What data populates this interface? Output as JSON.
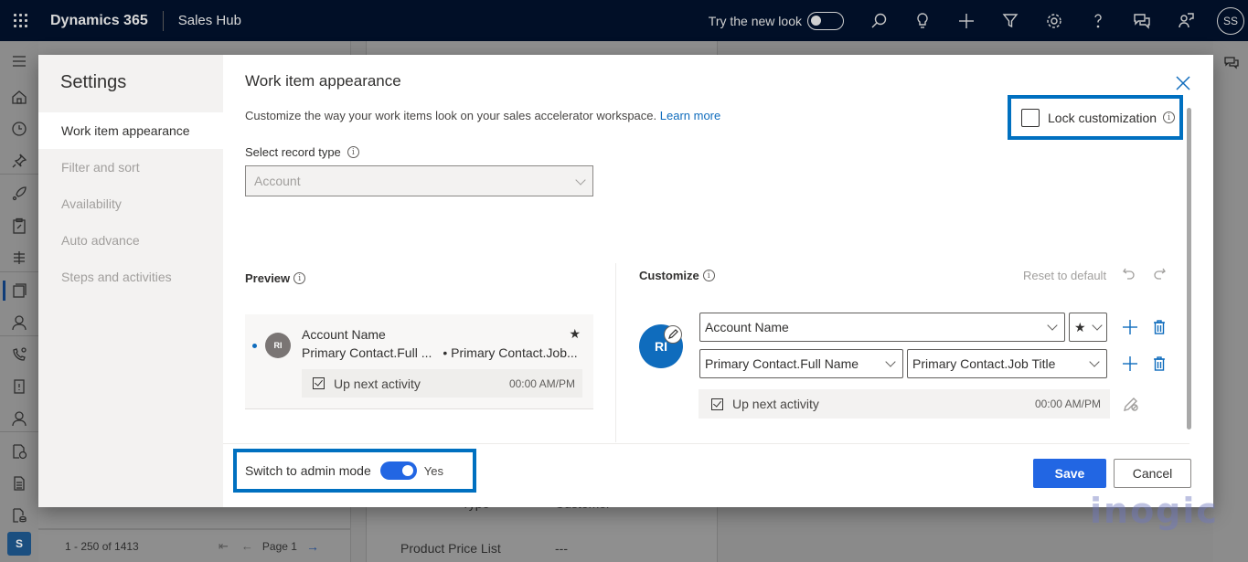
{
  "topbar": {
    "brand": "Dynamics 365",
    "app_name": "Sales Hub",
    "try_new_look_label": "Try the new look",
    "try_new_look_on": false,
    "avatar_initials": "SS",
    "icons": [
      "search-icon",
      "lightbulb-icon",
      "plus-icon",
      "filter-icon",
      "gear-icon",
      "help-icon",
      "chat-icon",
      "remote-assist-icon"
    ]
  },
  "rail": {
    "icons": [
      "hamburger-icon",
      "home-icon",
      "recent-icon",
      "pin-icon",
      "rocket-icon",
      "clipboard-icon",
      "sequence-icon",
      "workspace-icon",
      "contact-icon",
      "phone-settings-icon",
      "alert-doc-icon",
      "person-question-icon",
      "doc-clock-icon",
      "document-icon",
      "doc-stack-icon"
    ],
    "area_initial": "S"
  },
  "background": {
    "pager": {
      "count": "1 - 250 of 1413",
      "page": "Page 1"
    },
    "fields": [
      {
        "label": "Type",
        "value": "Customer"
      },
      {
        "label": "Product Price List",
        "value": "---"
      }
    ]
  },
  "dialog": {
    "sidebar_title": "Settings",
    "sidebar_items": [
      {
        "label": "Work item appearance",
        "active": true
      },
      {
        "label": "Filter and sort",
        "active": false
      },
      {
        "label": "Availability",
        "active": false
      },
      {
        "label": "Auto advance",
        "active": false
      },
      {
        "label": "Steps and activities",
        "active": false
      }
    ],
    "title": "Work item appearance",
    "description": "Customize the way your work items look on your sales accelerator workspace.",
    "learn_more": "Learn more",
    "lock_customization": {
      "label": "Lock customization",
      "checked": false
    },
    "record_type": {
      "label": "Select record type",
      "value": "Account",
      "disabled": true
    },
    "preview": {
      "label": "Preview",
      "avatar_initials": "RI",
      "name": "Account Name",
      "line2_a": "Primary Contact.Full ...",
      "line2_b": "• Primary Contact.Job...",
      "activity": "Up next activity",
      "time": "00:00 AM/PM"
    },
    "customize": {
      "label": "Customize",
      "reset_label": "Reset to default",
      "avatar_initials": "RI",
      "row1_field": "Account Name",
      "row1_icon": "★",
      "row2_field_a": "Primary Contact.Full Name",
      "row2_field_b": "Primary Contact.Job Title",
      "activity": "Up next activity",
      "time": "00:00 AM/PM"
    },
    "admin_mode": {
      "label": "Switch to admin mode",
      "on": true,
      "value_label": "Yes"
    },
    "save_label": "Save",
    "cancel_label": "Cancel"
  },
  "watermark": "inogic",
  "colors": {
    "topbar_bg": "#010f27",
    "accent_blue": "#2266e3",
    "highlight_border": "#0070c0",
    "link": "#0f6cbd"
  }
}
